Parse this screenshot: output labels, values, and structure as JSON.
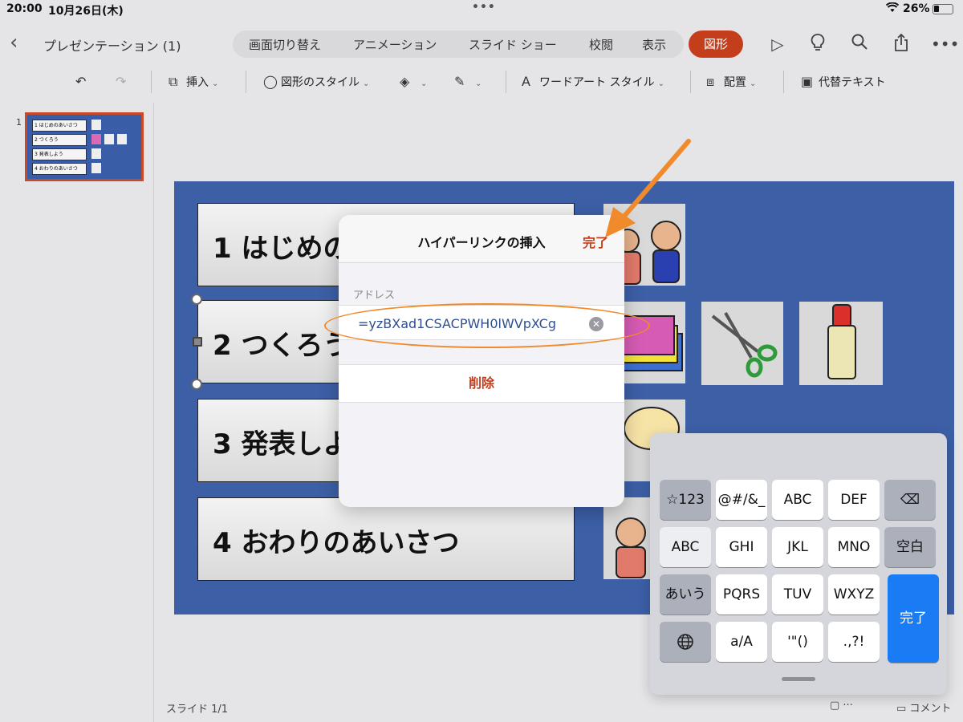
{
  "status_bar": {
    "time": "20:00",
    "date": "10月26日(木)",
    "battery": "26%"
  },
  "toolbar": {
    "doc_title": "プレゼンテーション (1)",
    "tabs": [
      "画面切り替え",
      "アニメーション",
      "スライド ショー",
      "校閲",
      "表示"
    ],
    "active_tab": "図形"
  },
  "ribbon": {
    "insert": "挿入",
    "shape_style": "図形のスタイル",
    "wordart_style": "ワードアート スタイル",
    "arrange": "配置",
    "alt_text": "代替テキスト"
  },
  "thumbnails": {
    "number": "1",
    "items": [
      "1 はじめのあいさつ",
      "2 つくろう",
      "3 発表しよう",
      "4 おわりのあいさつ"
    ]
  },
  "slide": {
    "items": [
      "1 はじめの",
      "2 つくろう",
      "3 発表しよ",
      "4 おわりのあいさつ"
    ]
  },
  "dialog": {
    "title": "ハイパーリンクの挿入",
    "done": "完了",
    "address_label": "アドレス",
    "address_value": "=yzBXad1CSACPWH0lWVpXCg",
    "delete": "削除"
  },
  "keyboard": {
    "rows": [
      [
        "☆123",
        "@#/&_",
        "ABC",
        "DEF",
        "⌫"
      ],
      [
        "ABC",
        "GHI",
        "JKL",
        "MNO",
        "空白"
      ],
      [
        "あいう",
        "PQRS",
        "TUV",
        "WXYZ"
      ],
      [
        "🌐",
        "a/A",
        "'\"()",
        ".,?!"
      ]
    ],
    "enter": "完了"
  },
  "footer": {
    "slide_count": "スライド 1/1",
    "comments": "コメント"
  },
  "colors": {
    "accent": "#c43e1c",
    "slide_bg": "#3c5fa6",
    "keyboard_blue": "#1a7cf5",
    "annotation": "#f08a2a"
  }
}
